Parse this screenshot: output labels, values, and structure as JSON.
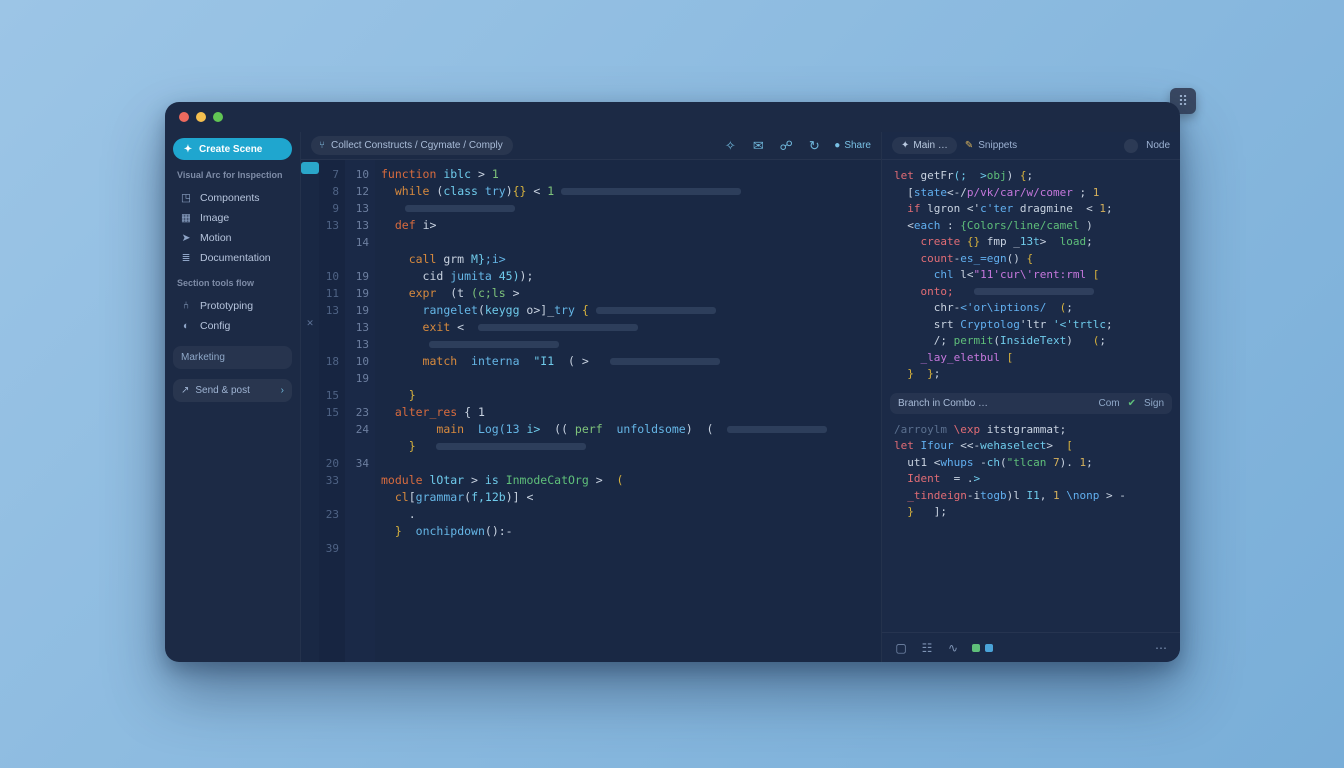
{
  "sidebar": {
    "create_label": "Create Scene",
    "heading1": "Visual Arc for Inspection",
    "items1": [
      {
        "icon": "cube",
        "label": "Components"
      },
      {
        "icon": "image",
        "label": "Image"
      },
      {
        "icon": "send",
        "label": "Motion"
      },
      {
        "icon": "stack",
        "label": "Documentation"
      }
    ],
    "heading2": "Section tools flow",
    "items2": [
      {
        "icon": "branch",
        "label": "Prototyping"
      },
      {
        "icon": "adjust",
        "label": "Config"
      }
    ],
    "marketing_label": "Marketing",
    "share_label": "Send & post"
  },
  "editor": {
    "breadcrumb": "Collect Constructs / Cgymate / Comply",
    "toolbar": {
      "share": "Share"
    },
    "gutter_left": [
      "7",
      "8",
      "9",
      "13",
      "",
      "",
      "10",
      "11",
      "13",
      "",
      "",
      "18",
      "",
      "15",
      "15",
      "",
      "",
      "20",
      "33",
      "",
      "23",
      "",
      "39"
    ],
    "gutter_right": [
      "10",
      "12",
      "13",
      "13",
      "14",
      "",
      "19",
      "19",
      "19",
      "13",
      "13",
      "10",
      "19",
      "",
      "23",
      "24",
      "",
      "34",
      "",
      "",
      "",
      "",
      ""
    ],
    "code": [
      [
        {
          "t": "function",
          "c": "kw"
        },
        {
          "t": " ",
          "c": "op"
        },
        {
          "t": "iblc",
          "c": "typ"
        },
        {
          "t": " > ",
          "c": "op"
        },
        {
          "t": "1",
          "c": "str"
        }
      ],
      [
        {
          "t": "  ",
          "c": "op"
        },
        {
          "t": "while",
          "c": "kw2"
        },
        {
          "t": " (",
          "c": "op"
        },
        {
          "t": "class",
          "c": "typ"
        },
        {
          "t": " ",
          "c": "op"
        },
        {
          "t": "try",
          "c": "fn"
        },
        {
          "t": ")",
          "c": "op"
        },
        {
          "t": "{}",
          "c": "pun"
        },
        {
          "t": " < ",
          "c": "op"
        },
        {
          "t": "1 ",
          "c": "str"
        },
        {
          "g": 180
        }
      ],
      [
        {
          "g": 110,
          "pad": 24
        }
      ],
      [
        {
          "t": "  ",
          "c": "op"
        },
        {
          "t": "def",
          "c": "kw"
        },
        {
          "t": " i>",
          "c": "op"
        }
      ],
      [],
      [
        {
          "t": "    ",
          "c": "op"
        },
        {
          "t": "call",
          "c": "kw2"
        },
        {
          "t": " grm ",
          "c": "op"
        },
        {
          "t": "M}",
          "c": "typ"
        },
        {
          "t": ";i>",
          "c": "fn"
        }
      ],
      [
        {
          "t": "      ",
          "c": "op"
        },
        {
          "t": "cid ",
          "c": "op"
        },
        {
          "t": "jumita",
          "c": "fn"
        },
        {
          "t": " ",
          "c": "op"
        },
        {
          "t": "45)",
          "c": "typ"
        },
        {
          "t": ");",
          "c": "op"
        }
      ],
      [
        {
          "t": "    ",
          "c": "op"
        },
        {
          "t": "expr",
          "c": "kw2"
        },
        {
          "t": "  (t ",
          "c": "op"
        },
        {
          "t": "(c;ls",
          "c": "str"
        },
        {
          "t": " >",
          "c": "op"
        }
      ],
      [
        {
          "t": "      ",
          "c": "op"
        },
        {
          "t": "rangelet",
          "c": "fn"
        },
        {
          "t": "(",
          "c": "op"
        },
        {
          "t": "keygg",
          "c": "typ"
        },
        {
          "t": " o>]_",
          "c": "op"
        },
        {
          "t": "try",
          "c": "fn"
        },
        {
          "t": " { ",
          "c": "pun"
        },
        {
          "g": 120
        }
      ],
      [
        {
          "t": "      ",
          "c": "op"
        },
        {
          "t": "exit",
          "c": "kw2"
        },
        {
          "t": " <  ",
          "c": "op"
        },
        {
          "g": 160
        }
      ],
      [
        {
          "g": 130,
          "pad": 48
        }
      ],
      [
        {
          "t": "      ",
          "c": "op"
        },
        {
          "t": "match",
          "c": "kw2"
        },
        {
          "t": "  ",
          "c": "op"
        },
        {
          "t": "interna",
          "c": "fn"
        },
        {
          "t": "  ",
          "c": "op"
        },
        {
          "t": "\"I1",
          "c": "typ"
        },
        {
          "t": "  ( >",
          "c": "op"
        },
        {
          "t": "   ",
          "c": "op"
        },
        {
          "g": 110
        }
      ],
      [],
      [
        {
          "t": "    ",
          "c": "op"
        },
        {
          "t": "}",
          "c": "pun"
        }
      ],
      [
        {
          "t": "  ",
          "c": "op"
        },
        {
          "t": "alter_res",
          "c": "kw"
        },
        {
          "t": " { 1",
          "c": "op"
        }
      ],
      [
        {
          "t": "        ",
          "c": "op"
        },
        {
          "t": "main",
          "c": "kw2"
        },
        {
          "t": "  ",
          "c": "op"
        },
        {
          "t": "Log(13",
          "c": "fn"
        },
        {
          "t": " ",
          "c": "op"
        },
        {
          "t": "i>",
          "c": "typ"
        },
        {
          "t": "  (( ",
          "c": "op"
        },
        {
          "t": "perf",
          "c": "str"
        },
        {
          "t": "  ",
          "c": "op"
        },
        {
          "t": "unfoldsome",
          "c": "fn"
        },
        {
          "t": ")  (",
          "c": "op"
        },
        {
          "t": "  ",
          "c": "op"
        },
        {
          "g": 100
        }
      ],
      [
        {
          "t": "    ",
          "c": "op"
        },
        {
          "t": "}",
          "c": "pun"
        },
        {
          "t": "   ",
          "c": "op"
        },
        {
          "g": 150
        }
      ],
      [],
      [
        {
          "t": "module",
          "c": "kw"
        },
        {
          "t": " ",
          "c": "op"
        },
        {
          "t": "lOtar",
          "c": "typ"
        },
        {
          "t": " > ",
          "c": "op"
        },
        {
          "t": "is",
          "c": "typ"
        },
        {
          "t": " ",
          "c": "op"
        },
        {
          "t": "InmodeCatOrg",
          "c": "grn"
        },
        {
          "t": " >  ",
          "c": "op"
        },
        {
          "t": "(",
          "c": "pun"
        }
      ],
      [
        {
          "t": "  ",
          "c": "op"
        },
        {
          "t": "cl",
          "c": "kw2"
        },
        {
          "t": "[",
          "c": "op"
        },
        {
          "t": "grammar",
          "c": "fn"
        },
        {
          "t": "(",
          "c": "op"
        },
        {
          "t": "f,12b",
          "c": "typ"
        },
        {
          "t": ")] <",
          "c": "op"
        }
      ],
      [
        {
          "t": "    .",
          "c": "op"
        }
      ],
      [
        {
          "t": "  ",
          "c": "op"
        },
        {
          "t": "}",
          "c": "pun"
        },
        {
          "t": "  ",
          "c": "op"
        },
        {
          "t": "onchipdown",
          "c": "fn"
        },
        {
          "t": "():-",
          "c": "op"
        }
      ],
      []
    ]
  },
  "right": {
    "tab1": "Main …",
    "tab2": "Snippets",
    "tab3": "Node",
    "block1": [
      [
        {
          "t": "let",
          "c": "red"
        },
        {
          "t": " getFr",
          "c": "op"
        },
        {
          "t": "(;  >",
          "c": "typ"
        },
        {
          "t": "obj",
          "c": "grn"
        },
        {
          "t": ") ",
          "c": "op"
        },
        {
          "t": "{",
          "c": "pun"
        },
        {
          "t": ";",
          "c": "op"
        }
      ],
      [
        {
          "t": "  [",
          "c": "op"
        },
        {
          "t": "state",
          "c": "blue"
        },
        {
          "t": "<-/",
          "c": "op"
        },
        {
          "t": "p/vk/car/w/comer",
          "c": "mag"
        },
        {
          "t": " ; ",
          "c": "op"
        },
        {
          "t": "1",
          "c": "num"
        }
      ],
      [
        {
          "t": "  ",
          "c": "op"
        },
        {
          "t": "if",
          "c": "red"
        },
        {
          "t": " lgron <'",
          "c": "op"
        },
        {
          "t": "c'ter",
          "c": "blue"
        },
        {
          "t": " dragmine  < ",
          "c": "op"
        },
        {
          "t": "1",
          "c": "num"
        },
        {
          "t": ";",
          "c": "op"
        }
      ],
      [
        {
          "t": "  <",
          "c": "op"
        },
        {
          "t": "each",
          "c": "blue"
        },
        {
          "t": " : ",
          "c": "op"
        },
        {
          "t": "{Colors/line/camel",
          "c": "grn"
        },
        {
          "t": " )",
          "c": "op"
        }
      ],
      [
        {
          "t": "    ",
          "c": "op"
        },
        {
          "t": "create",
          "c": "red"
        },
        {
          "t": " ",
          "c": "op"
        },
        {
          "t": "{}",
          "c": "pun"
        },
        {
          "t": " fmp _",
          "c": "op"
        },
        {
          "t": "13t",
          "c": "typ"
        },
        {
          "t": ">  ",
          "c": "op"
        },
        {
          "t": "load",
          "c": "grn"
        },
        {
          "t": ";",
          "c": "op"
        }
      ],
      [
        {
          "t": "    ",
          "c": "op"
        },
        {
          "t": "count",
          "c": "red"
        },
        {
          "t": "-",
          "c": "op"
        },
        {
          "t": "es_=egn",
          "c": "blue"
        },
        {
          "t": "() ",
          "c": "op"
        },
        {
          "t": "{",
          "c": "pun"
        }
      ],
      [
        {
          "t": "      ",
          "c": "op"
        },
        {
          "t": "chl",
          "c": "blue"
        },
        {
          "t": " l<",
          "c": "op"
        },
        {
          "t": "\"11'cur\\'rent:rml",
          "c": "mag"
        },
        {
          "t": " ",
          "c": "op"
        },
        {
          "t": "[",
          "c": "pun"
        }
      ],
      [
        {
          "t": "    ",
          "c": "op"
        },
        {
          "t": "onto;",
          "c": "red"
        },
        {
          "t": "   ",
          "c": "op"
        },
        {
          "g": 120
        }
      ],
      [
        {
          "t": "      chr-",
          "c": "op"
        },
        {
          "t": "<'or\\iptions/",
          "c": "blue"
        },
        {
          "t": "  ",
          "c": "op"
        },
        {
          "t": "(",
          "c": "pun"
        },
        {
          "t": ";",
          "c": "op"
        }
      ],
      [
        {
          "t": "      ",
          "c": "op"
        },
        {
          "t": "srt ",
          "c": "op"
        },
        {
          "t": "Cryptolog",
          "c": "blue"
        },
        {
          "t": "'ltr",
          "c": "op"
        },
        {
          "t": " '<'trtlc",
          "c": "typ"
        },
        {
          "t": ";",
          "c": "op"
        }
      ],
      [
        {
          "t": "      /; ",
          "c": "op"
        },
        {
          "t": "permit",
          "c": "grn"
        },
        {
          "t": "(",
          "c": "op"
        },
        {
          "t": "InsideText",
          "c": "typ"
        },
        {
          "t": ")   ",
          "c": "op"
        },
        {
          "t": "(",
          "c": "pun"
        },
        {
          "t": ";",
          "c": "op"
        }
      ],
      [
        {
          "t": "    ",
          "c": "op"
        },
        {
          "t": "_lay_eletbul",
          "c": "mag"
        },
        {
          "t": " ",
          "c": "op"
        },
        {
          "t": "[",
          "c": "pun"
        }
      ],
      [
        {
          "t": "  ",
          "c": "op"
        },
        {
          "t": "}",
          "c": "pun"
        },
        {
          "t": "  ",
          "c": "op"
        },
        {
          "t": "}",
          "c": "pun"
        },
        {
          "t": ";",
          "c": "op"
        }
      ]
    ],
    "sep_label": "Branch in Combo  …",
    "sep_right1": "Com",
    "sep_right2": "Sign",
    "block2": [
      [
        {
          "t": "/arroylm ",
          "c": "cmt"
        },
        {
          "t": "\\exp",
          "c": "red"
        },
        {
          "t": " itstgrammat",
          "c": "op"
        },
        {
          "t": ";",
          "c": "op"
        }
      ],
      [
        {
          "t": "let",
          "c": "red"
        },
        {
          "t": " ",
          "c": "op"
        },
        {
          "t": "Ifour",
          "c": "blue"
        },
        {
          "t": " <<-",
          "c": "op"
        },
        {
          "t": "wehaselect",
          "c": "typ"
        },
        {
          "t": ">  ",
          "c": "op"
        },
        {
          "t": "[",
          "c": "pun"
        }
      ],
      [
        {
          "t": "  ut1 ",
          "c": "op"
        },
        {
          "t": "<",
          "c": "op"
        },
        {
          "t": "whups",
          "c": "blue"
        },
        {
          "t": " -",
          "c": "op"
        },
        {
          "t": "ch",
          "c": "typ"
        },
        {
          "t": "(",
          "c": "op"
        },
        {
          "t": "\"tlcan",
          "c": "grn"
        },
        {
          "t": " ",
          "c": "op"
        },
        {
          "t": "7",
          "c": "num"
        },
        {
          "t": "). ",
          "c": "op"
        },
        {
          "t": "1",
          "c": "num"
        },
        {
          "t": ";",
          "c": "op"
        }
      ],
      [
        {
          "t": "  ",
          "c": "op"
        },
        {
          "t": "Ident",
          "c": "red"
        },
        {
          "t": "  = .",
          "c": "op"
        },
        {
          "t": ">",
          "c": "typ"
        }
      ],
      [
        {
          "t": "  ",
          "c": "op"
        },
        {
          "t": "_tindeign",
          "c": "red"
        },
        {
          "t": "-i",
          "c": "op"
        },
        {
          "t": "togb",
          "c": "blue"
        },
        {
          "t": ")l ",
          "c": "op"
        },
        {
          "t": "I1",
          "c": "typ"
        },
        {
          "t": ", ",
          "c": "op"
        },
        {
          "t": "1",
          "c": "num"
        },
        {
          "t": " ",
          "c": "op"
        },
        {
          "t": "\\nonp",
          "c": "blue"
        },
        {
          "t": " > ",
          "c": "op"
        },
        {
          "t": "-",
          "c": "op"
        }
      ],
      [
        {
          "t": "  ",
          "c": "op"
        },
        {
          "t": "}",
          "c": "pun"
        },
        {
          "t": "   ",
          "c": "op"
        },
        {
          "t": "];",
          "c": "op"
        }
      ]
    ]
  }
}
